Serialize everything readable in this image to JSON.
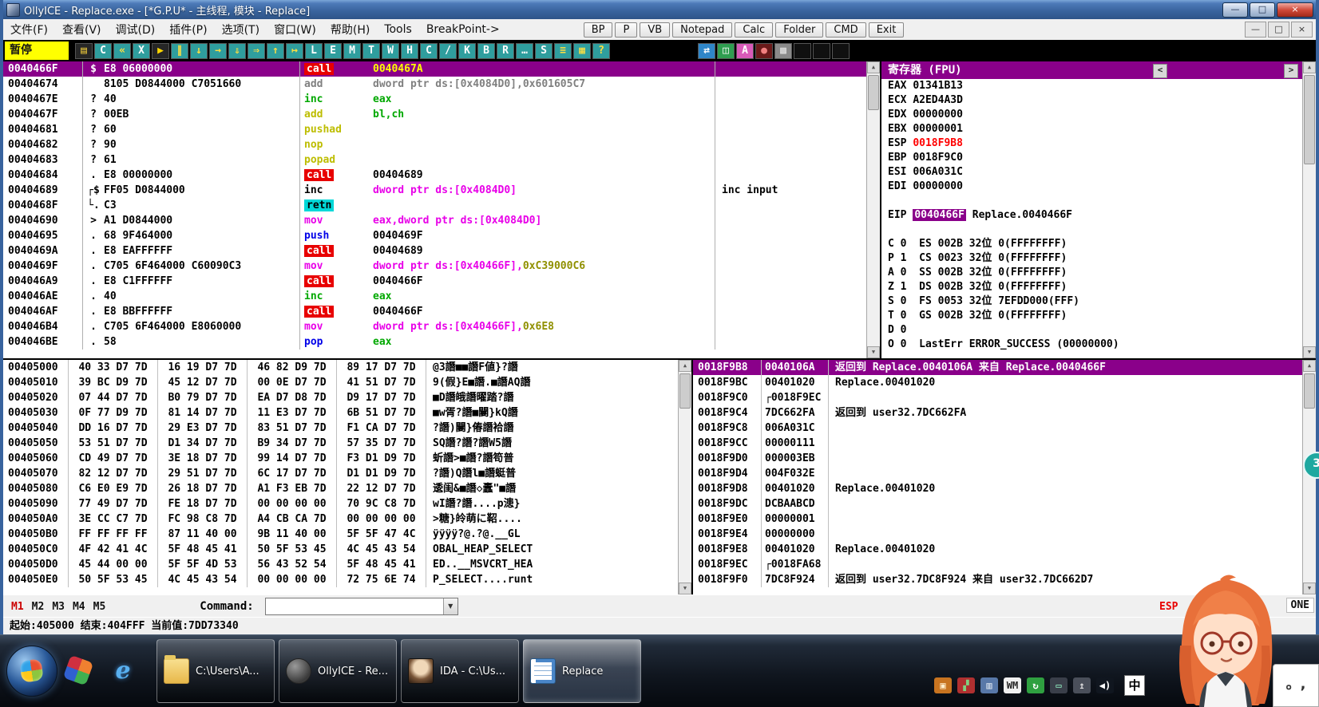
{
  "window": {
    "title": "OllyICE - Replace.exe - [*G.P.U* -  主线程, 模块 - Replace]",
    "controls": [
      "—",
      "□",
      "×"
    ]
  },
  "menu": {
    "items": [
      "文件(F)",
      "查看(V)",
      "调试(D)",
      "插件(P)",
      "选项(T)",
      "窗口(W)",
      "帮助(H)",
      "Tools",
      "BreakPoint->"
    ],
    "plugin_buttons": [
      "BP",
      "P",
      "VB",
      "Notepad",
      "Calc",
      "Folder",
      "CMD",
      "Exit"
    ],
    "mdi_controls": [
      "—",
      "□",
      "×"
    ]
  },
  "toolbar": {
    "pause_label": "暂停",
    "buttons": [
      {
        "n": "open-file",
        "g": "▤",
        "bg": "#262626",
        "fg": "#e8c53a"
      },
      {
        "n": "restart",
        "g": "C",
        "bg": "#2f9e9e",
        "fg": "#ffffff"
      },
      {
        "n": "step-back",
        "g": "«",
        "bg": "#2f9e9e",
        "fg": "#ffe040"
      },
      {
        "n": "close-program",
        "g": "X",
        "bg": "#2f9e9e",
        "fg": "#ffffff"
      },
      {
        "n": "run",
        "g": "▶",
        "bg": "#262626",
        "fg": "#ffd700"
      },
      {
        "n": "pause",
        "g": "∥",
        "bg": "#2f9e9e",
        "fg": "#ffe040"
      },
      {
        "n": "step-into",
        "g": "↓",
        "bg": "#2f9e9e",
        "fg": "#ffe040"
      },
      {
        "n": "step-over",
        "g": "→",
        "bg": "#2f9e9e",
        "fg": "#ffe040"
      },
      {
        "n": "trace-into",
        "g": "⇓",
        "bg": "#2f9e9e",
        "fg": "#ffe040"
      },
      {
        "n": "trace-over",
        "g": "⇒",
        "bg": "#2f9e9e",
        "fg": "#ffe040"
      },
      {
        "n": "execute-till-return",
        "g": "↑",
        "bg": "#2f9e9e",
        "fg": "#ffe040"
      },
      {
        "n": "go-to",
        "g": "↦",
        "bg": "#2f9e9e",
        "fg": "#ffe040"
      },
      {
        "n": "log-window",
        "g": "L",
        "bg": "#2f9e9e",
        "fg": "#ffffff"
      },
      {
        "n": "executables-window",
        "g": "E",
        "bg": "#2f9e9e",
        "fg": "#ffffff"
      },
      {
        "n": "memory-window",
        "g": "M",
        "bg": "#2f9e9e",
        "fg": "#ffffff"
      },
      {
        "n": "threads-window",
        "g": "T",
        "bg": "#2f9e9e",
        "fg": "#ffffff"
      },
      {
        "n": "windows-window",
        "g": "W",
        "bg": "#2f9e9e",
        "fg": "#ffffff"
      },
      {
        "n": "handles-window",
        "g": "H",
        "bg": "#2f9e9e",
        "fg": "#ffffff"
      },
      {
        "n": "cpu-window",
        "g": "C",
        "bg": "#2f9e9e",
        "fg": "#ffffff"
      },
      {
        "n": "patches-window",
        "g": "/",
        "bg": "#2f9e9e",
        "fg": "#ffffff"
      },
      {
        "n": "call-stack-window",
        "g": "K",
        "bg": "#2f9e9e",
        "fg": "#ffffff"
      },
      {
        "n": "breakpoints-window",
        "g": "B",
        "bg": "#2f9e9e",
        "fg": "#ffffff"
      },
      {
        "n": "references-window",
        "g": "R",
        "bg": "#2f9e9e",
        "fg": "#ffffff"
      },
      {
        "n": "run-trace-window",
        "g": "…",
        "bg": "#2f9e9e",
        "fg": "#ffffff"
      },
      {
        "n": "source-window",
        "g": "S",
        "bg": "#2f9e9e",
        "fg": "#ffffff"
      },
      {
        "n": "options",
        "g": "≡",
        "bg": "#2f9e9e",
        "fg": "#ffe040"
      },
      {
        "n": "appearance",
        "g": "▦",
        "bg": "#2f9e9e",
        "fg": "#ffe040"
      },
      {
        "n": "help",
        "g": "?",
        "bg": "#2f9e9e",
        "fg": "#ffe040"
      }
    ],
    "right_buttons": [
      {
        "n": "plugin-swap",
        "g": "⇄",
        "bg": "#2f86c8",
        "fg": "#ffffff"
      },
      {
        "n": "plugin-window",
        "g": "◫",
        "bg": "#2f9e50",
        "fg": "#ffffff"
      },
      {
        "n": "plugin-analyze",
        "g": "A",
        "bg": "#d85ab8",
        "fg": "#ffffff"
      },
      {
        "n": "plugin-record",
        "g": "●",
        "bg": "#6a1a1a",
        "fg": "#f08080"
      },
      {
        "n": "plugin-grid",
        "g": "▩",
        "bg": "#8a8a8a",
        "fg": "#e0e0e0"
      },
      {
        "n": "plugin-blank-1",
        "g": "",
        "bg": "#101010",
        "fg": "#101010"
      },
      {
        "n": "plugin-blank-2",
        "g": "",
        "bg": "#101010",
        "fg": "#101010"
      },
      {
        "n": "plugin-blank-3",
        "g": "",
        "bg": "#101010",
        "fg": "#101010"
      }
    ]
  },
  "disasm": {
    "rows": [
      {
        "a": "0040466F",
        "p": "$",
        "b": "E8 06000000",
        "m": "call",
        "mc": "m-call",
        "o": [
          [
            "0040467A",
            "o-sel"
          ]
        ],
        "c": "",
        "sel": true
      },
      {
        "a": "00404674",
        "p": "",
        "b": "8105 D0844000 C7051660",
        "m": "add",
        "mc": "t-gray",
        "o": [
          [
            "dword ptr ds:[0x4084D0],0x601605C7",
            "t-gray"
          ]
        ],
        "c": ""
      },
      {
        "a": "0040467E",
        "p": "?",
        "b": "40",
        "m": "inc",
        "mc": "t-green",
        "o": [
          [
            "eax",
            "t-green"
          ]
        ],
        "c": ""
      },
      {
        "a": "0040467F",
        "p": "?",
        "b": "00EB",
        "m": "add",
        "mc": "t-yel",
        "o": [
          [
            "bl,ch",
            "t-green"
          ]
        ],
        "c": ""
      },
      {
        "a": "00404681",
        "p": "?",
        "b": "60",
        "m": "pushad",
        "mc": "t-yel",
        "o": [],
        "c": ""
      },
      {
        "a": "00404682",
        "p": "?",
        "b": "90",
        "m": "nop",
        "mc": "t-yel",
        "o": [],
        "c": ""
      },
      {
        "a": "00404683",
        "p": "?",
        "b": "61",
        "m": "popad",
        "mc": "t-yel",
        "o": [],
        "c": ""
      },
      {
        "a": "00404684",
        "p": ".",
        "b": "E8 00000000",
        "m": "call",
        "mc": "m-call",
        "o": [
          [
            "00404689",
            "t-k"
          ]
        ],
        "c": ""
      },
      {
        "a": "00404689",
        "p": "┌$",
        "b": "FF05 D0844000",
        "m": "inc",
        "mc": "t-k",
        "o": [
          [
            "dword ptr ds:[0x4084D0]",
            "t-mag"
          ]
        ],
        "c": "inc input"
      },
      {
        "a": "0040468F",
        "p": "└.",
        "b": "C3",
        "m": "retn",
        "mc": "m-retn",
        "o": [],
        "c": ""
      },
      {
        "a": "00404690",
        "p": ">",
        "b": "A1 D0844000",
        "m": "mov",
        "mc": "t-mag",
        "o": [
          [
            "eax,dword ptr ds:[0x4084D0]",
            "t-mag"
          ]
        ],
        "c": ""
      },
      {
        "a": "00404695",
        "p": ".",
        "b": "68 9F464000",
        "m": "push",
        "mc": "t-blue",
        "o": [
          [
            "0040469F",
            "t-k"
          ]
        ],
        "c": ""
      },
      {
        "a": "0040469A",
        "p": ".",
        "b": "E8 EAFFFFFF",
        "m": "call",
        "mc": "m-call",
        "o": [
          [
            "00404689",
            "t-k"
          ]
        ],
        "c": ""
      },
      {
        "a": "0040469F",
        "p": ".",
        "b": "C705 6F464000 C60090C3",
        "m": "mov",
        "mc": "t-mag",
        "o": [
          [
            "dword ptr ds:[0x40466F],",
            "t-mag"
          ],
          [
            "0xC39000C6",
            "t-olive"
          ]
        ],
        "c": ""
      },
      {
        "a": "004046A9",
        "p": ".",
        "b": "E8 C1FFFFFF",
        "m": "call",
        "mc": "m-call",
        "o": [
          [
            "0040466F",
            "t-k"
          ]
        ],
        "c": ""
      },
      {
        "a": "004046AE",
        "p": ".",
        "b": "40",
        "m": "inc",
        "mc": "t-green",
        "o": [
          [
            "eax",
            "t-green"
          ]
        ],
        "c": ""
      },
      {
        "a": "004046AF",
        "p": ".",
        "b": "E8 BBFFFFFF",
        "m": "call",
        "mc": "m-call",
        "o": [
          [
            "0040466F",
            "t-k"
          ]
        ],
        "c": ""
      },
      {
        "a": "004046B4",
        "p": ".",
        "b": "C705 6F464000 E8060000",
        "m": "mov",
        "mc": "t-mag",
        "o": [
          [
            "dword ptr ds:[0x40466F],",
            "t-mag"
          ],
          [
            "0x6E8",
            "t-olive"
          ]
        ],
        "c": ""
      },
      {
        "a": "004046BE",
        "p": ".",
        "b": "58",
        "m": "pop",
        "mc": "t-blue",
        "o": [
          [
            "eax",
            "t-green"
          ]
        ],
        "c": ""
      }
    ]
  },
  "registers": {
    "header": "寄存器 (FPU)",
    "scroll_left": "<",
    "scroll_right": ">",
    "rows": [
      {
        "s": [
          [
            "EAX ",
            "t-k"
          ],
          [
            "01341B13",
            "t-k"
          ]
        ]
      },
      {
        "s": [
          [
            "ECX ",
            "t-k"
          ],
          [
            "A2ED4A3D",
            "t-k"
          ]
        ]
      },
      {
        "s": [
          [
            "EDX ",
            "t-k"
          ],
          [
            "00000000",
            "t-k"
          ]
        ]
      },
      {
        "s": [
          [
            "EBX ",
            "t-k"
          ],
          [
            "00000001",
            "t-k"
          ]
        ]
      },
      {
        "s": [
          [
            "ESP ",
            "t-k"
          ],
          [
            "0018F9B8",
            "t-red"
          ]
        ]
      },
      {
        "s": [
          [
            "EBP ",
            "t-k"
          ],
          [
            "0018F9C0",
            "t-k"
          ]
        ]
      },
      {
        "s": [
          [
            "ESI ",
            "t-k"
          ],
          [
            "006A031C",
            "t-k"
          ]
        ]
      },
      {
        "s": [
          [
            "EDI ",
            "t-k"
          ],
          [
            "00000000",
            "t-k"
          ]
        ]
      },
      {
        "s": []
      },
      {
        "s": [
          [
            "EIP ",
            "t-k"
          ],
          [
            "0040466F",
            "v-eip"
          ],
          [
            " Replace.0040466F",
            "t-k"
          ]
        ]
      },
      {
        "s": []
      },
      {
        "s": [
          [
            "C 0  ES 002B 32位 0(FFFFFFFF)",
            "t-k"
          ]
        ]
      },
      {
        "s": [
          [
            "P 1  CS 0023 32位 0(FFFFFFFF)",
            "t-k"
          ]
        ]
      },
      {
        "s": [
          [
            "A 0  SS 002B 32位 0(FFFFFFFF)",
            "t-k"
          ]
        ]
      },
      {
        "s": [
          [
            "Z 1  DS 002B 32位 0(FFFFFFFF)",
            "t-k"
          ]
        ]
      },
      {
        "s": [
          [
            "S 0  FS 0053 32位 7EFDD000(FFF)",
            "t-k"
          ]
        ]
      },
      {
        "s": [
          [
            "T 0  GS 002B 32位 0(FFFFFFFF)",
            "t-k"
          ]
        ]
      },
      {
        "s": [
          [
            "D 0",
            "t-k"
          ]
        ]
      },
      {
        "s": [
          [
            "O 0  LastErr ERROR_SUCCESS (00000000)",
            "t-k"
          ]
        ]
      }
    ]
  },
  "dump": {
    "rows": [
      {
        "a": "00405000",
        "h": [
          "40 33 D7 7D",
          "16 19 D7 7D",
          "46 82 D9 7D",
          "89 17 D7 7D"
        ],
        "t": "@3譖■■譖F値}?譖"
      },
      {
        "a": "00405010",
        "h": [
          "39 BC D9 7D",
          "45 12 D7 7D",
          "00 0E D7 7D",
          "41 51 D7 7D"
        ],
        "t": "9(假}E■譖.■譖AQ譖"
      },
      {
        "a": "00405020",
        "h": [
          "07 44 D7 7D",
          "B0 79 D7 7D",
          "EA D7 D8 7D",
          "D9 17 D7 7D"
        ],
        "t": "■D譖皒譖曜踏?譖"
      },
      {
        "a": "00405030",
        "h": [
          "0F 77 D9 7D",
          "81 14 D7 7D",
          "11 E3 D7 7D",
          "6B 51 D7 7D"
        ],
        "t": "■w胥?譖■闄}kQ譖"
      },
      {
        "a": "00405040",
        "h": [
          "DD 16 D7 7D",
          "29 E3 D7 7D",
          "83 51 D7 7D",
          "F1 CA D7 7D"
        ],
        "t": "?譖)闄}偆譖袷譖"
      },
      {
        "a": "00405050",
        "h": [
          "53 51 D7 7D",
          "D1 34 D7 7D",
          "B9 34 D7 7D",
          "57 35 D7 7D"
        ],
        "t": "SQ譖?譖?譖W5譖"
      },
      {
        "a": "00405060",
        "h": [
          "CD 49 D7 7D",
          "3E 18 D7 7D",
          "99 14 D7 7D",
          "F3 D1 D9 7D"
        ],
        "t": "蚚譖>■譖?譖笱普"
      },
      {
        "a": "00405070",
        "h": [
          "82 12 D7 7D",
          "29 51 D7 7D",
          "6C 17 D7 7D",
          "D1 D1 D9 7D"
        ],
        "t": "?譖)Q譖l■譖蜓普"
      },
      {
        "a": "00405080",
        "h": [
          "C6 E0 E9 7D",
          "26 18 D7 7D",
          "A1 F3 EB 7D",
          "22 12 D7 7D"
        ],
        "t": "逶闺&■譖◇蠹\"■譖"
      },
      {
        "a": "00405090",
        "h": [
          "77 49 D7 7D",
          "FE 18 D7 7D",
          "00 00 00 00",
          "70 9C C8 7D"
        ],
        "t": "wI譖?譖....p漶}"
      },
      {
        "a": "004050A0",
        "h": [
          "3E CC C7 7D",
          "FC 98 C8 7D",
          "A4 CB CA 7D",
          "00 00 00 00"
        ],
        "t": ">糖}皊萌に鞀...."
      },
      {
        "a": "004050B0",
        "h": [
          "FF FF FF FF",
          "87 11 40 00",
          "9B 11 40 00",
          "5F 5F 47 4C"
        ],
        "t": "ÿÿÿÿ?@.?@.__GL"
      },
      {
        "a": "004050C0",
        "h": [
          "4F 42 41 4C",
          "5F 48 45 41",
          "50 5F 53 45",
          "4C 45 43 54"
        ],
        "t": "OBAL_HEAP_SELECT"
      },
      {
        "a": "004050D0",
        "h": [
          "45 44 00 00",
          "5F 5F 4D 53",
          "56 43 52 54",
          "5F 48 45 41"
        ],
        "t": "ED..__MSVCRT_HEA"
      },
      {
        "a": "004050E0",
        "h": [
          "50 5F 53 45",
          "4C 45 43 54",
          "00 00 00 00",
          "72 75 6E 74"
        ],
        "t": "P_SELECT....runt"
      }
    ]
  },
  "stack": {
    "rows": [
      {
        "a": "0018F9B8",
        "v": "0040106A",
        "c": "返回到 Replace.0040106A 来自 Replace.0040466F",
        "sel": true
      },
      {
        "a": "0018F9BC",
        "v": "00401020",
        "c": "Replace.00401020"
      },
      {
        "a": "0018F9C0",
        "v": "0018F9EC",
        "f": true,
        "c": ""
      },
      {
        "a": "0018F9C4",
        "v": "7DC662FA",
        "c": "返回到 user32.7DC662FA"
      },
      {
        "a": "0018F9C8",
        "v": "006A031C",
        "c": ""
      },
      {
        "a": "0018F9CC",
        "v": "00000111",
        "c": ""
      },
      {
        "a": "0018F9D0",
        "v": "000003EB",
        "c": ""
      },
      {
        "a": "0018F9D4",
        "v": "004F032E",
        "c": ""
      },
      {
        "a": "0018F9D8",
        "v": "00401020",
        "c": "Replace.00401020"
      },
      {
        "a": "0018F9DC",
        "v": "DCBAABCD",
        "c": ""
      },
      {
        "a": "0018F9E0",
        "v": "00000001",
        "c": ""
      },
      {
        "a": "0018F9E4",
        "v": "00000000",
        "c": ""
      },
      {
        "a": "0018F9E8",
        "v": "00401020",
        "c": "Replace.00401020"
      },
      {
        "a": "0018F9EC",
        "v": "0018FA68",
        "f": true,
        "c": ""
      },
      {
        "a": "0018F9F0",
        "v": "7DC8F924",
        "c": "返回到 user32.7DC8F924 来自 user32.7DC662D7"
      }
    ]
  },
  "command_bar": {
    "m_labels": [
      "M1",
      "M2",
      "M3",
      "M4",
      "M5"
    ],
    "command_label": "Command:",
    "dropdown_glyph": "▼",
    "esp_label": "ESP",
    "one_label": "ONE"
  },
  "status_bar": {
    "text": "起始:405000 结束:404FFF 当前值:7DD73340"
  },
  "taskbar": {
    "quick_icons": [
      {
        "n": "pinwheel"
      },
      {
        "n": "internet-explorer",
        "g": "e"
      }
    ],
    "windows": [
      {
        "label": "C:\\Users\\A...",
        "icon": "folder"
      },
      {
        "label": "OllyICE - Re...",
        "icon": "olly"
      },
      {
        "label": "IDA - C:\\Us...",
        "icon": "ida"
      },
      {
        "label": "Replace",
        "icon": "replace",
        "active": true
      }
    ],
    "tray": [
      {
        "n": "orange-app",
        "g": "▣",
        "bg": "#c87420",
        "fg": "#ffeecc"
      },
      {
        "n": "color-grid",
        "g": "▞",
        "bg": "#b03030",
        "fg": "#80d080"
      },
      {
        "n": "chip",
        "g": "▥",
        "bg": "#5878a8",
        "fg": "#dde6f0"
      },
      {
        "n": "wm",
        "g": "WM",
        "bg": "#f0f0f0",
        "fg": "#222222"
      },
      {
        "n": "sync",
        "g": "↻",
        "bg": "#2fa040",
        "fg": "#ffffff"
      },
      {
        "n": "display",
        "g": "▭",
        "bg": "#3a3f4a",
        "fg": "#99ffcc"
      },
      {
        "n": "usb",
        "g": "↥",
        "bg": "#4a4f5a",
        "fg": "#dddddd"
      },
      {
        "n": "volume",
        "g": "◀)",
        "bg": "#10161f",
        "fg": "#ffffff"
      }
    ],
    "lang": "中"
  },
  "ime": {
    "text": "。,"
  },
  "badge": {
    "text": "3"
  },
  "ui": {
    "scroll_up": "▲",
    "scroll_down": "▼"
  }
}
